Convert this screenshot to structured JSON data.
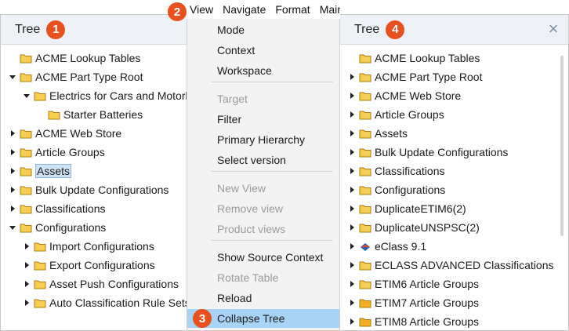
{
  "left_panel": {
    "title": "Tree",
    "badge": "1",
    "items": [
      {
        "label": "ACME Lookup Tables",
        "indent": 0,
        "arrow": "none"
      },
      {
        "label": "ACME Part Type Root",
        "indent": 0,
        "arrow": "down"
      },
      {
        "label": "Electrics for Cars and Motorb",
        "indent": 1,
        "arrow": "down"
      },
      {
        "label": "Starter Batteries",
        "indent": 2,
        "arrow": "none"
      },
      {
        "label": "ACME Web Store",
        "indent": 0,
        "arrow": "right"
      },
      {
        "label": "Article Groups",
        "indent": 0,
        "arrow": "right"
      },
      {
        "label": "Assets",
        "indent": 0,
        "arrow": "right",
        "selected": true
      },
      {
        "label": "Bulk Update Configurations",
        "indent": 0,
        "arrow": "right"
      },
      {
        "label": "Classifications",
        "indent": 0,
        "arrow": "right"
      },
      {
        "label": "Configurations",
        "indent": 0,
        "arrow": "down"
      },
      {
        "label": "Import Configurations",
        "indent": 1,
        "arrow": "right"
      },
      {
        "label": "Export Configurations",
        "indent": 1,
        "arrow": "right"
      },
      {
        "label": "Asset Push Configurations",
        "indent": 1,
        "arrow": "right"
      },
      {
        "label": "Auto Classification Rule Sets",
        "indent": 1,
        "arrow": "right"
      }
    ]
  },
  "menubar": {
    "badge": "2",
    "items": [
      "View",
      "Navigate",
      "Format",
      "Mainta"
    ]
  },
  "dropdown": {
    "items": [
      {
        "label": "Mode",
        "disabled": false
      },
      {
        "label": "Context",
        "disabled": false
      },
      {
        "label": "Workspace",
        "disabled": false
      },
      {
        "label": "Target",
        "disabled": true
      },
      {
        "label": "Filter",
        "disabled": false
      },
      {
        "label": "Primary Hierarchy",
        "disabled": false
      },
      {
        "label": "Select version",
        "disabled": false
      },
      {
        "label": "New View",
        "disabled": true
      },
      {
        "label": "Remove view",
        "disabled": true
      },
      {
        "label": "Product views",
        "disabled": true
      },
      {
        "label": "Show Source Context",
        "disabled": false
      },
      {
        "label": "Rotate Table",
        "disabled": true
      },
      {
        "label": "Reload",
        "disabled": false
      },
      {
        "label": "Collapse Tree",
        "disabled": false,
        "active": true
      }
    ],
    "active_badge": "3"
  },
  "right_panel": {
    "title": "Tree",
    "badge": "4",
    "close_icon": "×",
    "items": [
      {
        "label": "ACME Lookup Tables",
        "arrow": "none",
        "icon": "folder"
      },
      {
        "label": "ACME Part Type Root",
        "arrow": "right",
        "icon": "folder"
      },
      {
        "label": "ACME Web Store",
        "arrow": "right",
        "icon": "folder"
      },
      {
        "label": "Article Groups",
        "arrow": "right",
        "icon": "folder"
      },
      {
        "label": "Assets",
        "arrow": "right",
        "icon": "folder"
      },
      {
        "label": "Bulk Update Configurations",
        "arrow": "right",
        "icon": "folder"
      },
      {
        "label": "Classifications",
        "arrow": "right",
        "icon": "folder"
      },
      {
        "label": "Configurations",
        "arrow": "right",
        "icon": "folder"
      },
      {
        "label": "DuplicateETIM6(2)",
        "arrow": "right",
        "icon": "folder"
      },
      {
        "label": "DuplicateUNSPSC(2)",
        "arrow": "right",
        "icon": "folder"
      },
      {
        "label": "eClass 9.1",
        "arrow": "right",
        "icon": "eclass"
      },
      {
        "label": "ECLASS ADVANCED Classifications",
        "arrow": "right",
        "icon": "folder"
      },
      {
        "label": "ETIM6 Article Groups",
        "arrow": "right",
        "icon": "folder"
      },
      {
        "label": "ETIM7 Article Groups",
        "arrow": "right",
        "icon": "folder-filled"
      },
      {
        "label": "ETIM8 Article Groups",
        "arrow": "right",
        "icon": "folder-filled"
      }
    ]
  }
}
